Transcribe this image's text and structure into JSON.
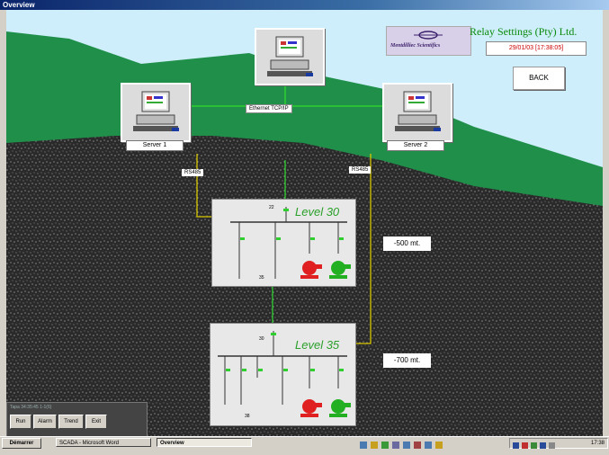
{
  "window": {
    "title": "Overview"
  },
  "header": {
    "company": "Relay Settings (Pty) Ltd.",
    "logo_text": "Mentdilliec Scientifics",
    "datetime": "29/01/03 [17:38:05]",
    "back_label": "BACK"
  },
  "network": {
    "ethernet_label": "Ethernet TCP/IP",
    "server1_label": "Server 1",
    "server2_label": "Server 2",
    "rs485_left": "RS485",
    "rs485_right": "RS485"
  },
  "levels": [
    {
      "title": "Level 30",
      "depth": "-500 mt.",
      "num_top": "22",
      "num_bottom": "35"
    },
    {
      "title": "Level 35",
      "depth": "-700 mt.",
      "num_top": "30",
      "num_bottom": "38"
    }
  ],
  "control_panel": {
    "status": "Tapa 34:35:45 1-1(6)",
    "buttons": [
      "Run",
      "Alarm",
      "Trend",
      "Exit"
    ]
  },
  "taskbar": {
    "start": "Démarrer",
    "tasks": [
      "SCADA - Microsoft Word",
      "Overview"
    ],
    "clock": "17:38"
  },
  "colors": {
    "grass": "#1f8f4a",
    "line_green": "#2fcf2f",
    "line_yellow": "#d8c800",
    "pump_red": "#e02020",
    "pump_green": "#22b022"
  }
}
